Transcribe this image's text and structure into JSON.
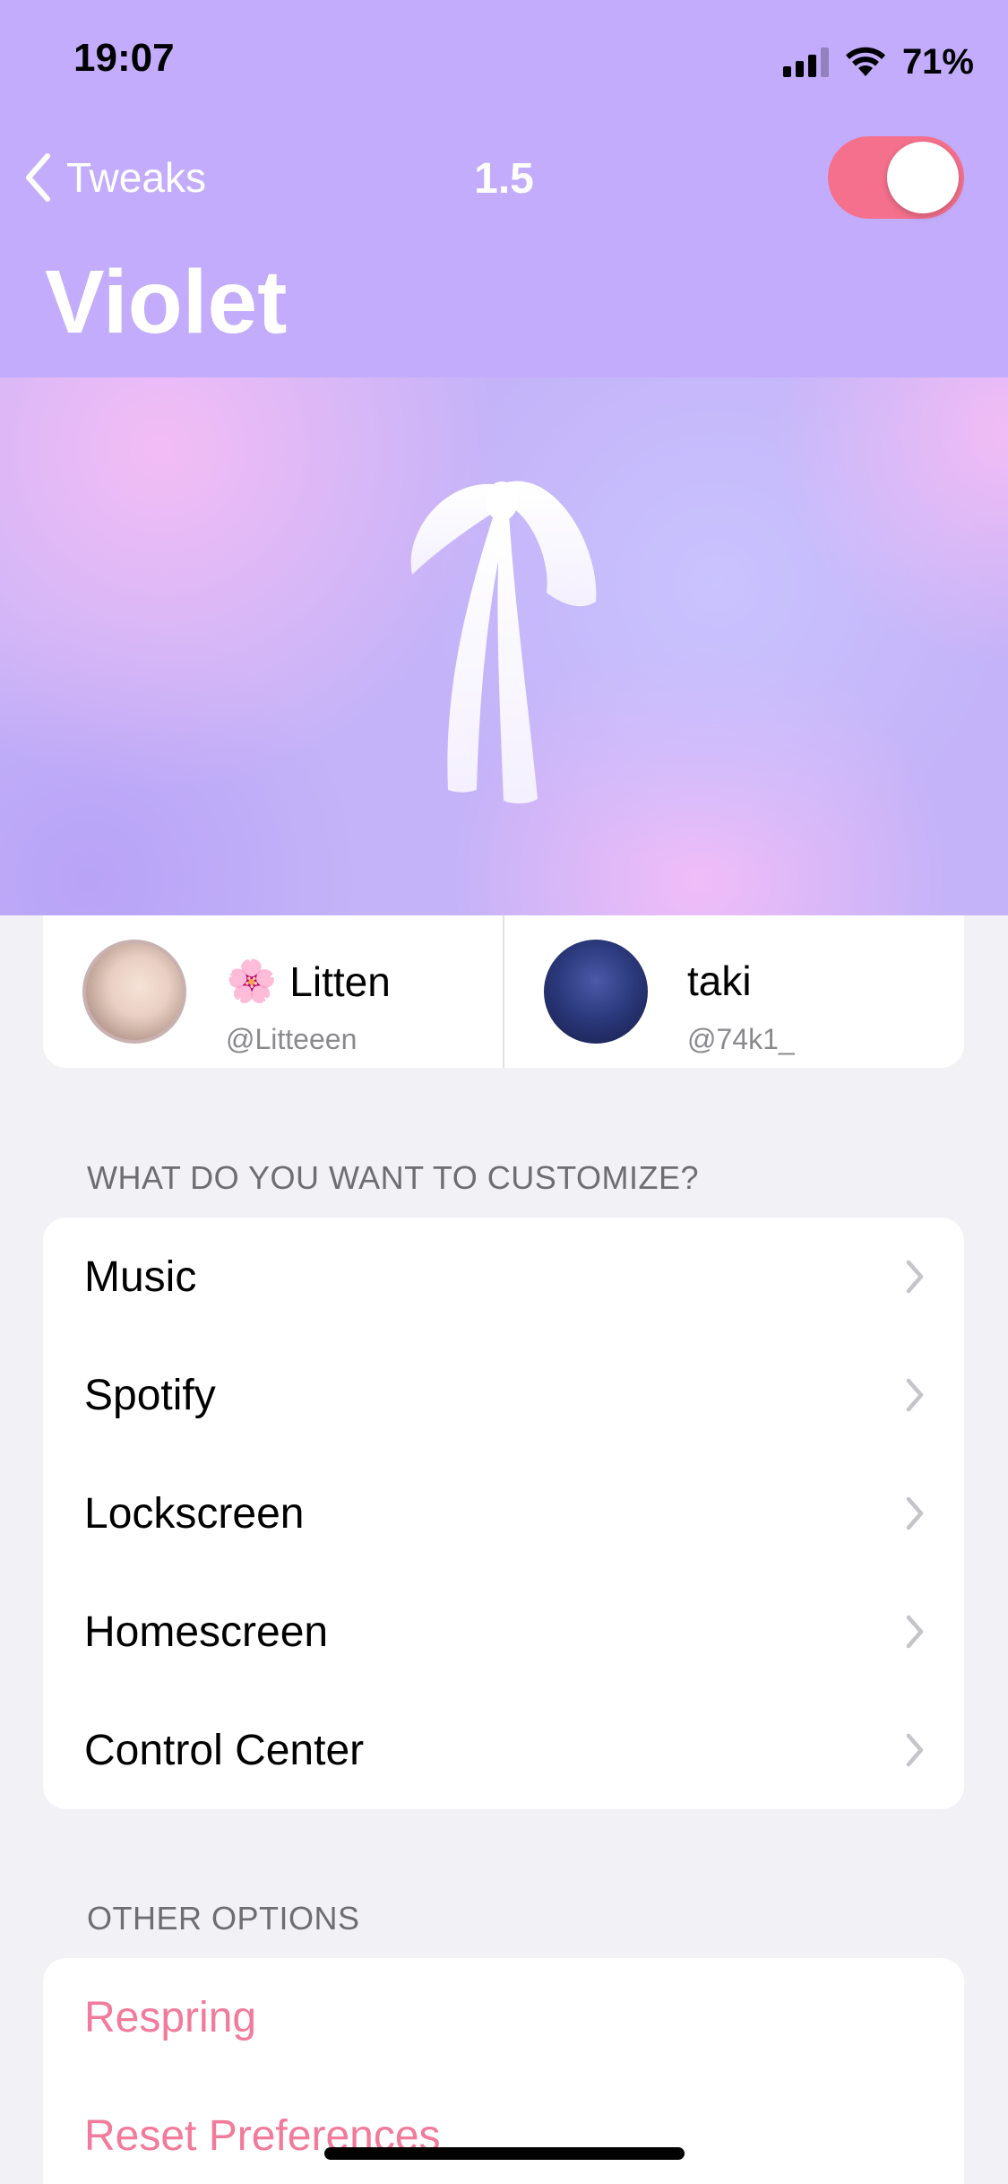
{
  "status_bar": {
    "time": "19:07",
    "battery": "71%"
  },
  "nav": {
    "back_label": "Tweaks",
    "version": "1.5",
    "enabled": true,
    "title": "Violet"
  },
  "colors": {
    "header": "#c2acfb",
    "toggle_on": "#f5708c",
    "accent_pink": "#f27a9b"
  },
  "credits": [
    {
      "emoji": "🌸",
      "name": "Litten",
      "handle": "@Litteeen"
    },
    {
      "emoji": "",
      "name": "taki",
      "handle": "@74k1_"
    }
  ],
  "customize": {
    "header": "WHAT DO YOU WANT TO CUSTOMIZE?",
    "items": [
      "Music",
      "Spotify",
      "Lockscreen",
      "Homescreen",
      "Control Center"
    ]
  },
  "other": {
    "header": "OTHER OPTIONS",
    "items": [
      "Respring",
      "Reset Preferences"
    ]
  }
}
